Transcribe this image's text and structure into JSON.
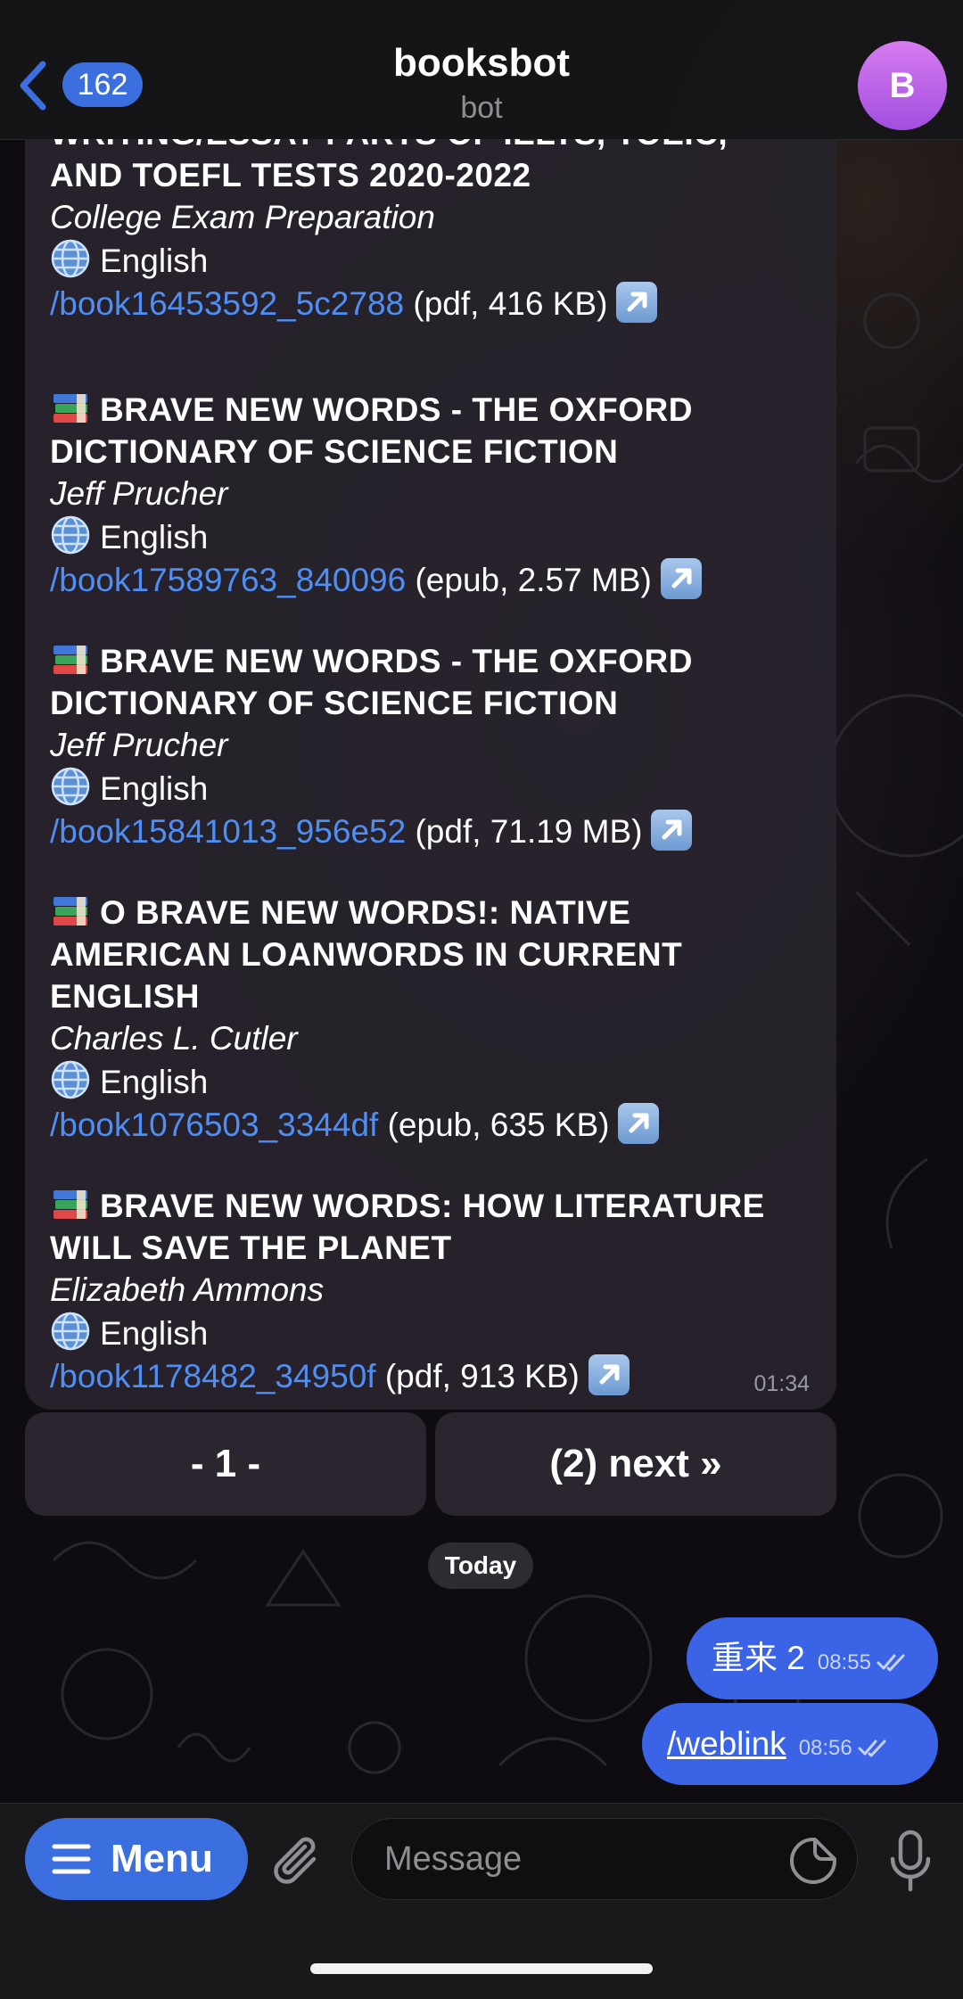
{
  "header": {
    "back_count": "162",
    "title": "booksbot",
    "subtitle": "bot",
    "avatar_initial": "B"
  },
  "results": [
    {
      "title_line1": "WRITING/ESSAY PARTS OF IELTS, TOEIC,",
      "title_line2": "AND TOEFL TESTS 2020-2022",
      "author": "College Exam Preparation",
      "language": "English",
      "link": "/book16453592_5c2788",
      "format": " (pdf, 416 KB)"
    },
    {
      "title_line1": "BRAVE NEW WORDS - THE OXFORD",
      "title_line2": "DICTIONARY OF SCIENCE FICTION",
      "author": "Jeff Prucher",
      "language": "English",
      "link": "/book17589763_840096",
      "format": " (epub, 2.57 MB)"
    },
    {
      "title_line1": "BRAVE NEW WORDS - THE OXFORD",
      "title_line2": "DICTIONARY OF SCIENCE FICTION",
      "author": "Jeff Prucher",
      "language": "English",
      "link": "/book15841013_956e52",
      "format": " (pdf, 71.19 MB)"
    },
    {
      "title_line1": "O BRAVE NEW WORDS!: NATIVE",
      "title_line2": "AMERICAN LOANWORDS IN CURRENT",
      "title_line3": "ENGLISH",
      "author": "Charles L. Cutler",
      "language": "English",
      "link": "/book1076503_3344df",
      "format": " (epub, 635 KB)"
    },
    {
      "title_line1": "BRAVE NEW WORDS: HOW LITERATURE",
      "title_line2": "WILL SAVE THE PLANET",
      "author": "Elizabeth Ammons",
      "language": "English",
      "link": "/book1178482_34950f",
      "format": " (pdf, 913 KB)"
    }
  ],
  "bot_message_time": "01:34",
  "keyboard": {
    "page_current": "- 1 -",
    "page_next": "(2) next »"
  },
  "date_separator": "Today",
  "outgoing": [
    {
      "text": "重来 2",
      "time": "08:55"
    },
    {
      "text": "/weblink",
      "time": "08:56"
    }
  ],
  "input_bar": {
    "menu_label": "Menu",
    "message_placeholder": "Message"
  },
  "colors": {
    "accent": "#3b6fe0",
    "link": "#4f8ef5",
    "outgoing_bubble": "#3a63e6"
  }
}
